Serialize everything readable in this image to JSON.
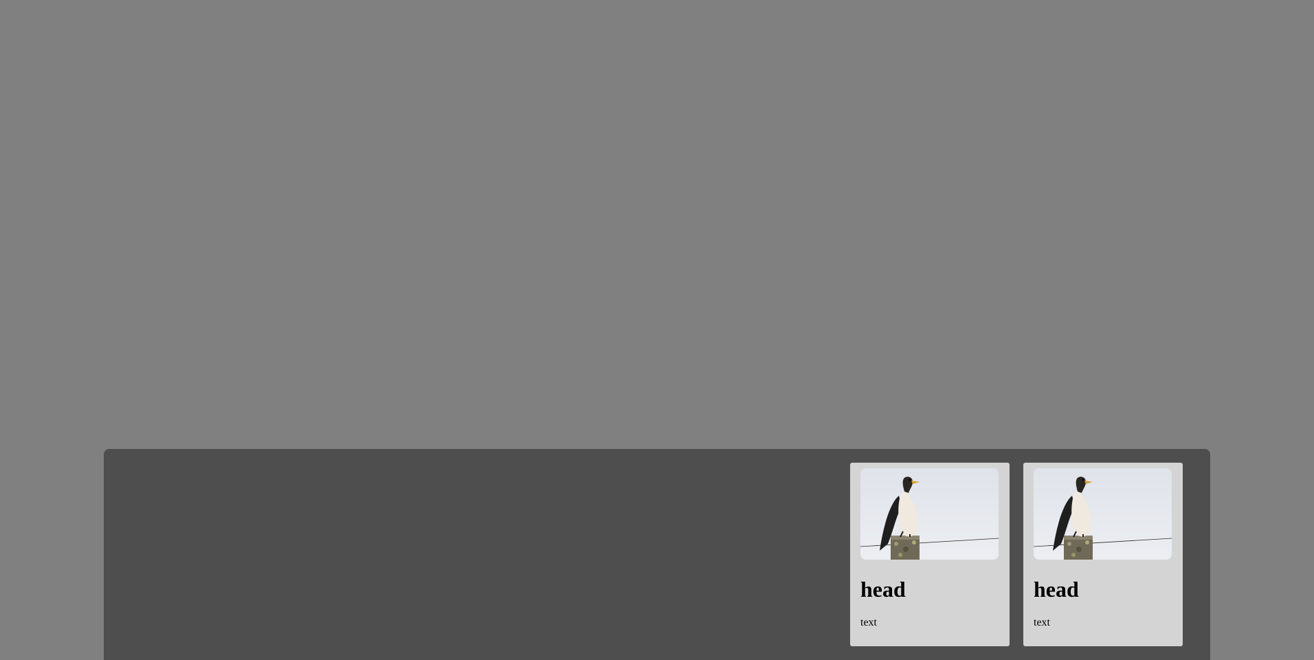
{
  "cards": [
    {
      "image_name": "cormorant-on-post-photo",
      "head": "head",
      "text": "text"
    },
    {
      "image_name": "cormorant-on-post-photo",
      "head": "head",
      "text": "text"
    }
  ],
  "colors": {
    "page_background": "#808080",
    "panel_background": "#4e4e4e",
    "card_background": "#d4d4d4",
    "image_sky": "#e3e7ec"
  }
}
